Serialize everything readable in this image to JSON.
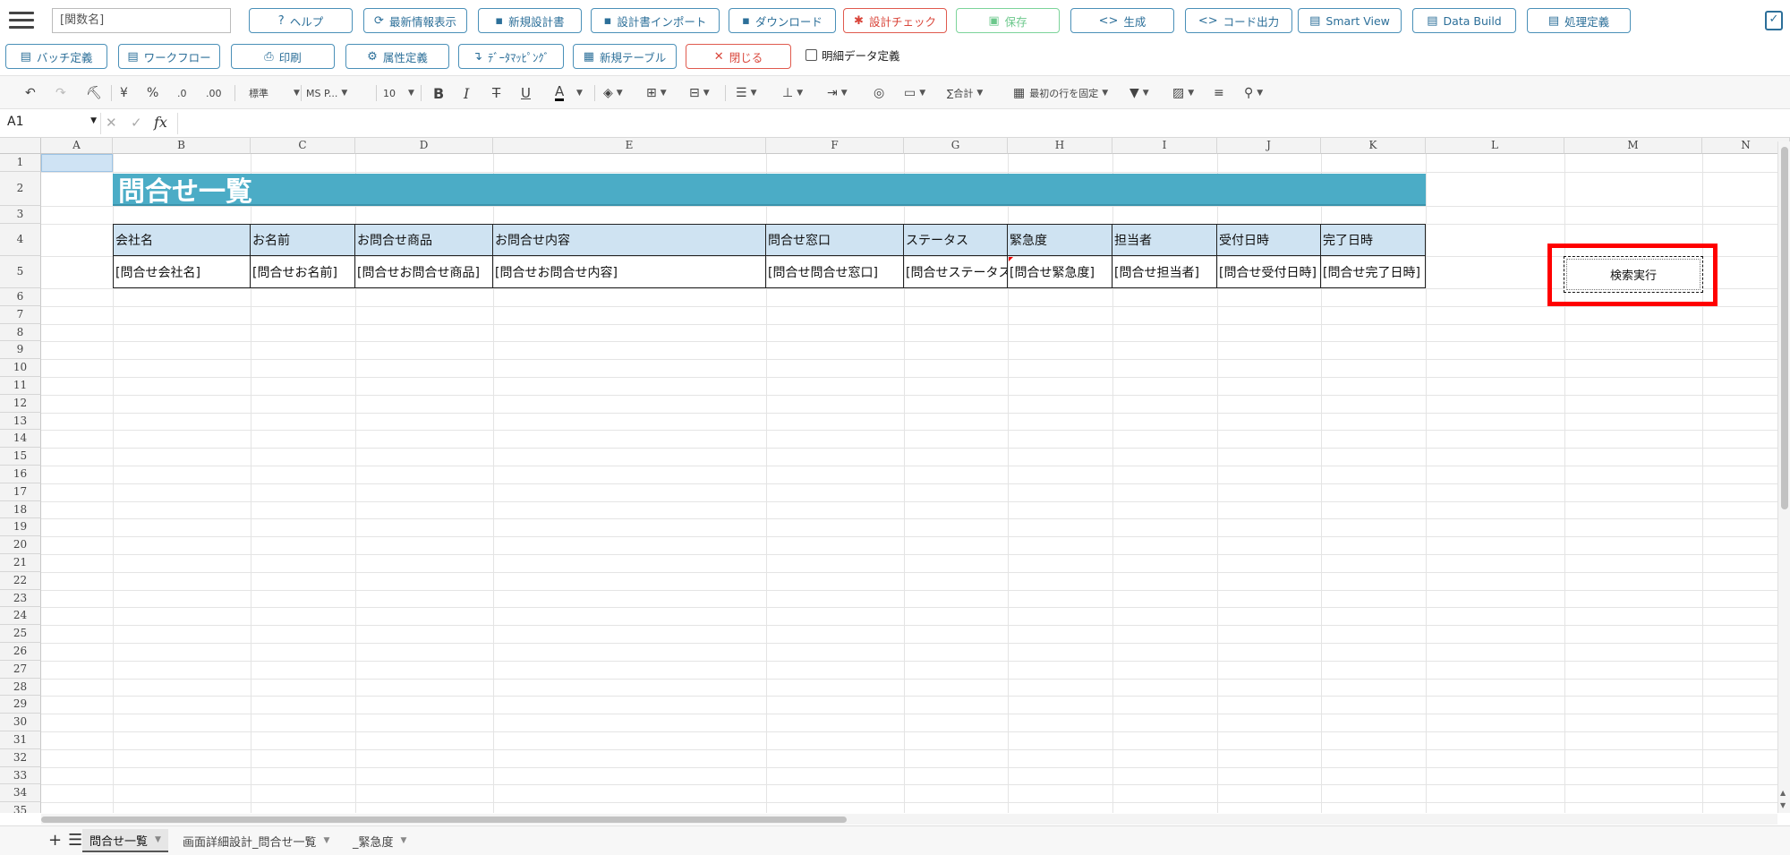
{
  "toolbar": {
    "function_name_placeholder": "[関数名]",
    "buttons": [
      {
        "label": "ヘルプ",
        "icon": "help-icon",
        "glyph": "?"
      },
      {
        "label": "最新情報表示",
        "icon": "refresh-icon",
        "glyph": "⟳"
      },
      {
        "label": "新規設計書",
        "icon": "new-file-icon",
        "glyph": "▪"
      },
      {
        "label": "設計書インポート",
        "icon": "import-icon",
        "glyph": "▪"
      },
      {
        "label": "ダウンロード",
        "icon": "download-icon",
        "glyph": "▪"
      },
      {
        "label": "設計チェック",
        "icon": "bug-icon",
        "glyph": "✱"
      },
      {
        "label": "保存",
        "icon": "save-icon",
        "glyph": "▣"
      },
      {
        "label": "生成",
        "icon": "code-icon",
        "glyph": "<>"
      },
      {
        "label": "コード出力",
        "icon": "code-icon",
        "glyph": "<>"
      },
      {
        "label": "Smart View",
        "icon": "document-icon",
        "glyph": "▤"
      },
      {
        "label": "Data Build",
        "icon": "document-icon",
        "glyph": "▤"
      },
      {
        "label": "処理定義",
        "icon": "document-icon",
        "glyph": "▤"
      }
    ],
    "buttons_row2": [
      {
        "label": "バッチ定義",
        "icon": "document-icon",
        "glyph": "▤"
      },
      {
        "label": "ワークフロー",
        "icon": "document-icon",
        "glyph": "▤"
      },
      {
        "label": "印刷",
        "icon": "print-icon",
        "glyph": "⎙"
      },
      {
        "label": "属性定義",
        "icon": "gear-icon",
        "glyph": "⚙"
      },
      {
        "label": "ﾃﾞｰﾀﾏｯﾋﾟﾝｸﾞ",
        "icon": "arrow-icon",
        "glyph": "↴"
      },
      {
        "label": "新規テーブル",
        "icon": "table-icon",
        "glyph": "▦"
      },
      {
        "label": "閉じる",
        "icon": "close-icon",
        "glyph": "✕"
      }
    ],
    "detail_checkbox_label": "明細データ定義",
    "corner_icon": "clipboard-check-icon"
  },
  "ribbon": {
    "number_format": "標準",
    "font_name": "MS P...",
    "font_size": "10",
    "currency": "¥",
    "percent": "%",
    "dec_inc": ".0",
    "dec_dec": ".00",
    "bold": "B",
    "italic": "I",
    "strike": "T",
    "underline": "U",
    "font_color": "A",
    "sum": "∑合計",
    "freeze": "最初の行を固定"
  },
  "formula_bar": {
    "cell_ref": "A1",
    "fx_label": "fx",
    "formula": ""
  },
  "grid": {
    "columns": [
      "A",
      "B",
      "C",
      "D",
      "E",
      "F",
      "G",
      "H",
      "I",
      "J",
      "K",
      "L",
      "M",
      "N"
    ],
    "rows": [
      "1",
      "2",
      "3",
      "4",
      "5",
      "6",
      "7",
      "8",
      "9",
      "10",
      "11",
      "12",
      "13",
      "14",
      "15",
      "16",
      "17",
      "18",
      "19",
      "20",
      "21",
      "22",
      "23",
      "24",
      "25",
      "26",
      "27",
      "28",
      "29",
      "30",
      "31",
      "32",
      "33",
      "34",
      "35"
    ]
  },
  "sheet": {
    "title": "問合せ一覧",
    "headers": [
      "会社名",
      "お名前",
      "お問合せ商品",
      "お問合せ内容",
      "問合せ窓口",
      "ステータス",
      "緊急度",
      "担当者",
      "受付日時",
      "完了日時"
    ],
    "placeholders": [
      "[問合せ会社名]",
      "[問合せお名前]",
      "[問合せお問合せ商品]",
      "[問合せお問合せ内容]",
      "[問合せ問合せ窓口]",
      "[問合せステータス]",
      "[問合せ緊急度]",
      "[問合せ担当者]",
      "[問合せ受付日時]",
      "[問合せ完了日時]"
    ],
    "search_button": "検索実行"
  },
  "tabs": [
    {
      "label": "問合せ一覧",
      "active": true
    },
    {
      "label": "画面詳細設計_問合せ一覧",
      "active": false
    },
    {
      "label": "_緊急度",
      "active": false
    }
  ],
  "colors": {
    "accent": "#4a90b8",
    "title_fill": "#4bacc6",
    "header_fill": "#cfe3f2",
    "highlight": "#ff0000"
  }
}
